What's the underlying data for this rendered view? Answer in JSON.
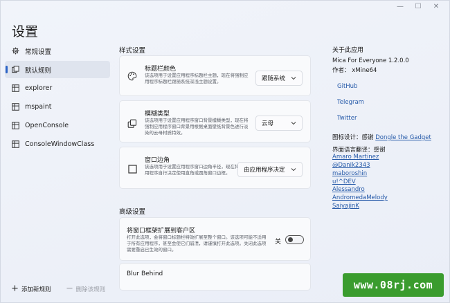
{
  "app": {
    "title": "设置",
    "colors": {
      "accent": "#2b63c6",
      "link": "#2559a8",
      "watermark": "#3a9c2e"
    }
  },
  "window_controls": {
    "minimize": "—",
    "maximize": "☐",
    "close": "✕"
  },
  "sidebar": {
    "items": [
      {
        "label": "常规设置",
        "icon": "gear-icon",
        "selected": false
      },
      {
        "label": "默认规则",
        "icon": "rules-icon",
        "selected": true
      },
      {
        "label": "explorer",
        "icon": "rule-icon",
        "selected": false
      },
      {
        "label": "mspaint",
        "icon": "rule-icon",
        "selected": false
      },
      {
        "label": "OpenConsole",
        "icon": "rule-icon",
        "selected": false
      },
      {
        "label": "ConsoleWindowClass",
        "icon": "rule-icon",
        "selected": false
      }
    ]
  },
  "bottom_bar": {
    "add_label": "添加新规则",
    "delete_label": "删除该规则"
  },
  "style_section": {
    "title": "样式设置",
    "titlebar_color": {
      "title": "标题栏颜色",
      "desc": "该选项用于设置应用程序标题栏主题，现在将强制应用程序标题栏跟随系统深浅主题设置。",
      "value": "跟随系统"
    },
    "blur_type": {
      "title": "模糊类型",
      "desc": "该选项用于设置应用程序窗口背景模糊类型，现在将强制应用程序窗口背景用根据桌面壁纸背景色进行淡染的云母材质特效。",
      "value": "云母"
    },
    "corner": {
      "title": "窗口边角",
      "desc": "该选项用于设置应用程序窗口边角半径，现在将由应用程序自行决定使用直角或圆角窗口边框。",
      "value": "由应用程序决定"
    }
  },
  "advanced_section": {
    "title": "高级设置",
    "extend_frame": {
      "title": "将窗口框架扩展到客户区",
      "desc": "打开此选项，会将窗口标题栏特效扩展至整个窗口。该选项可能不适用于所有应用程序，甚至会使它们崩溃，请谨慎打开此选项。关闭此选项需要重启已生效的窗口。",
      "state_label": "关",
      "checked": false
    },
    "next_card_title": "Blur Behind"
  },
  "about": {
    "title": "关于此应用",
    "version": "Mica For Everyone 1.2.0.0",
    "author": "作者：  xMine64",
    "links": [
      "GitHub",
      "Telegram",
      "Twitter"
    ],
    "icon_credit_prefix": "图标设计：感谢",
    "icon_credit_name": "Dongle the Gadget",
    "translators_title": "界面语言翻译：感谢",
    "translators": [
      "Amaro Martinez",
      "@Danik2343",
      "maboroshin",
      "u!^DEV",
      "Alessandro",
      "AndromedaMelody",
      "SaiyajinK"
    ]
  },
  "watermark": {
    "text": "www.08rj.com"
  }
}
